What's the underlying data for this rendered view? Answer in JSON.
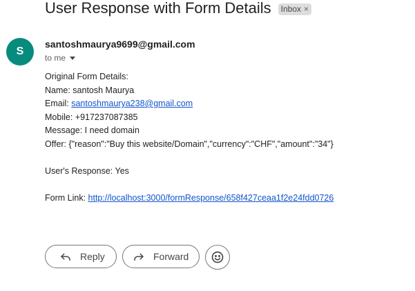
{
  "email": {
    "subject": "User Response with Form Details",
    "label": "Inbox",
    "label_close": "×",
    "sender_initial": "S",
    "sender": "santoshmaurya9699@gmail.com",
    "recipient": "to me"
  },
  "body": {
    "heading": "Original Form Details:",
    "name_line": "Name: santosh Maurya",
    "email_prefix": "Email: ",
    "email_value": "santoshmaurya238@gmail.com",
    "mobile_line": "Mobile: +917237087385",
    "message_line": "Message: I need domain",
    "offer_line": "Offer: {\"reason\":\"Buy this website/Domain\",\"currency\":\"CHF\",\"amount\":\"34\"}",
    "response_line": "User's Response: Yes",
    "form_link_prefix": "Form Link: ",
    "form_link_value": "http://localhost:3000/formResponse/658f427ceaa1f2e24fdd0726"
  },
  "actions": {
    "reply_label": "Reply",
    "forward_label": "Forward",
    "reply_icon": "reply-arrow",
    "forward_icon": "forward-arrow",
    "emoji_icon": "smiley-face"
  },
  "colors": {
    "avatar_bg": "#078b7c",
    "link": "#1155cc",
    "label_chip_bg": "#dddddd"
  }
}
